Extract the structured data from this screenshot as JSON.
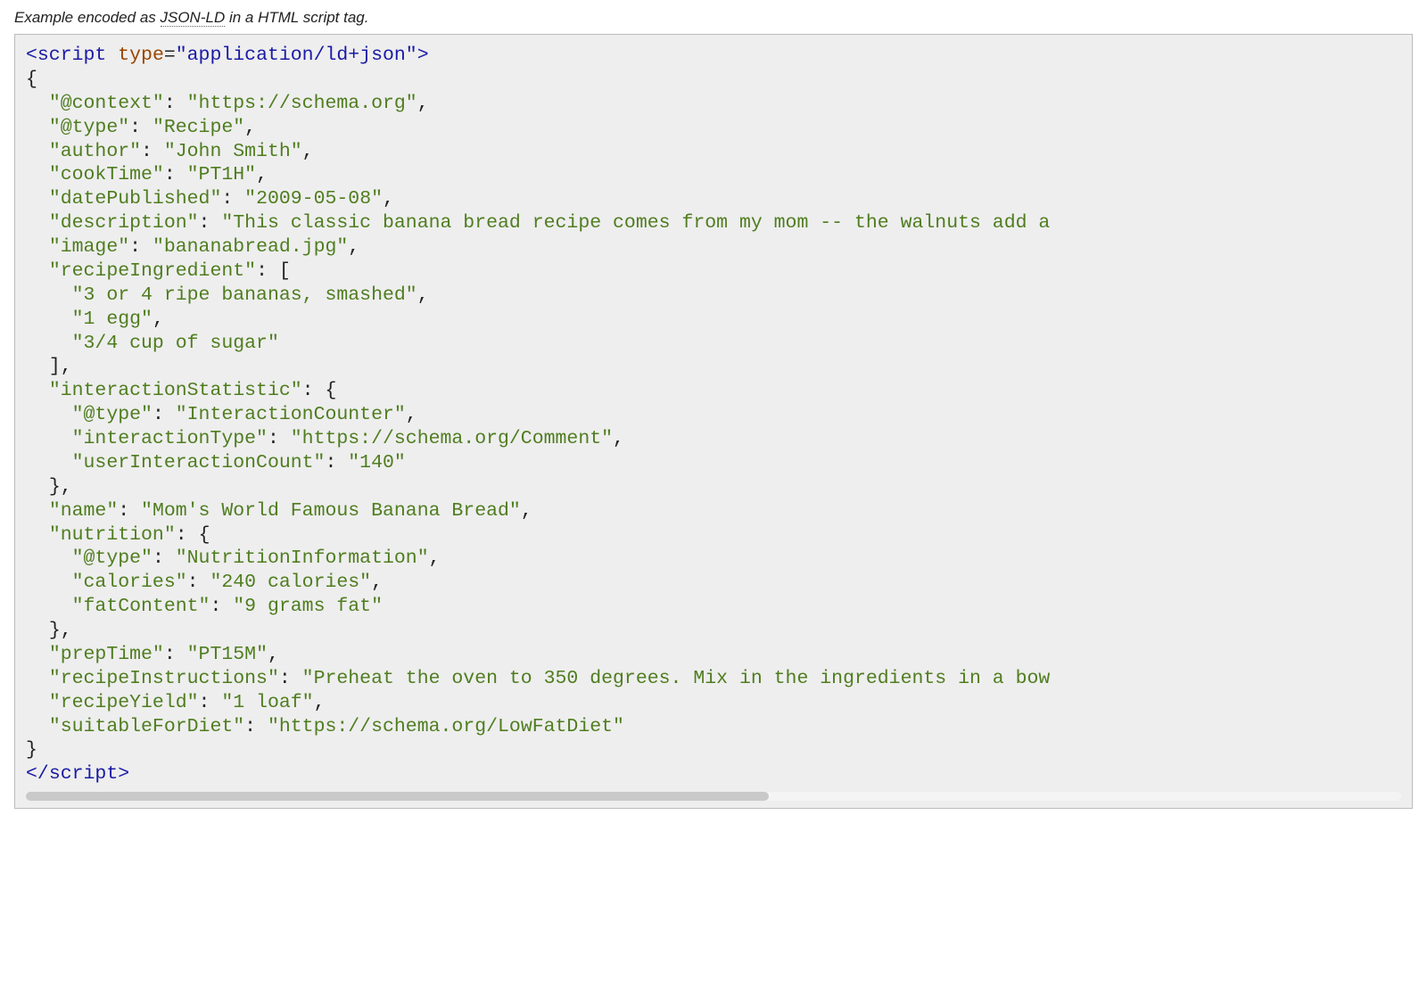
{
  "caption": {
    "prefix": "Example encoded as ",
    "link_text": "JSON-LD",
    "suffix": " in a HTML script tag."
  },
  "code": {
    "open_tag": {
      "name": "script",
      "attr_name": "type",
      "attr_value": "\"application/ld+json\""
    },
    "lbrace": "{",
    "rbrace": "}",
    "close_tag": "script",
    "lines": {
      "context": {
        "key": "\"@context\"",
        "sep": ": ",
        "val": "\"https://schema.org\"",
        "end": ","
      },
      "type": {
        "key": "\"@type\"",
        "sep": ": ",
        "val": "\"Recipe\"",
        "end": ","
      },
      "author": {
        "key": "\"author\"",
        "sep": ": ",
        "val": "\"John Smith\"",
        "end": ","
      },
      "cookTime": {
        "key": "\"cookTime\"",
        "sep": ": ",
        "val": "\"PT1H\"",
        "end": ","
      },
      "datePublished": {
        "key": "\"datePublished\"",
        "sep": ": ",
        "val": "\"2009-05-08\"",
        "end": ","
      },
      "description": {
        "key": "\"description\"",
        "sep": ": ",
        "val": "\"This classic banana bread recipe comes from my mom -- the walnuts add a ",
        "end": ""
      },
      "image": {
        "key": "\"image\"",
        "sep": ": ",
        "val": "\"bananabread.jpg\"",
        "end": ","
      },
      "recipeIngredient_open": {
        "key": "\"recipeIngredient\"",
        "sep": ": ",
        "bracket": "["
      },
      "ing0": {
        "val": "\"3 or 4 ripe bananas, smashed\"",
        "end": ","
      },
      "ing1": {
        "val": "\"1 egg\"",
        "end": ","
      },
      "ing2": {
        "val": "\"3/4 cup of sugar\"",
        "end": ""
      },
      "arr_close": {
        "bracket": "]",
        "end": ","
      },
      "interactionStatistic_open": {
        "key": "\"interactionStatistic\"",
        "sep": ": ",
        "bracket": "{"
      },
      "is_type": {
        "key": "\"@type\"",
        "sep": ": ",
        "val": "\"InteractionCounter\"",
        "end": ","
      },
      "is_itype": {
        "key": "\"interactionType\"",
        "sep": ": ",
        "val": "\"https://schema.org/Comment\"",
        "end": ","
      },
      "is_count": {
        "key": "\"userInteractionCount\"",
        "sep": ": ",
        "val": "\"140\"",
        "end": ""
      },
      "obj_close1": {
        "bracket": "}",
        "end": ","
      },
      "name": {
        "key": "\"name\"",
        "sep": ": ",
        "val": "\"Mom's World Famous Banana Bread\"",
        "end": ","
      },
      "nutrition_open": {
        "key": "\"nutrition\"",
        "sep": ": ",
        "bracket": "{"
      },
      "nut_type": {
        "key": "\"@type\"",
        "sep": ": ",
        "val": "\"NutritionInformation\"",
        "end": ","
      },
      "nut_cal": {
        "key": "\"calories\"",
        "sep": ": ",
        "val": "\"240 calories\"",
        "end": ","
      },
      "nut_fat": {
        "key": "\"fatContent\"",
        "sep": ": ",
        "val": "\"9 grams fat\"",
        "end": ""
      },
      "obj_close2": {
        "bracket": "}",
        "end": ","
      },
      "prepTime": {
        "key": "\"prepTime\"",
        "sep": ": ",
        "val": "\"PT15M\"",
        "end": ","
      },
      "recipeInstructions": {
        "key": "\"recipeInstructions\"",
        "sep": ": ",
        "val": "\"Preheat the oven to 350 degrees. Mix in the ingredients in a bow",
        "end": ""
      },
      "recipeYield": {
        "key": "\"recipeYield\"",
        "sep": ": ",
        "val": "\"1 loaf\"",
        "end": ","
      },
      "suitableForDiet": {
        "key": "\"suitableForDiet\"",
        "sep": ": ",
        "val": "\"https://schema.org/LowFatDiet\"",
        "end": ""
      }
    }
  }
}
